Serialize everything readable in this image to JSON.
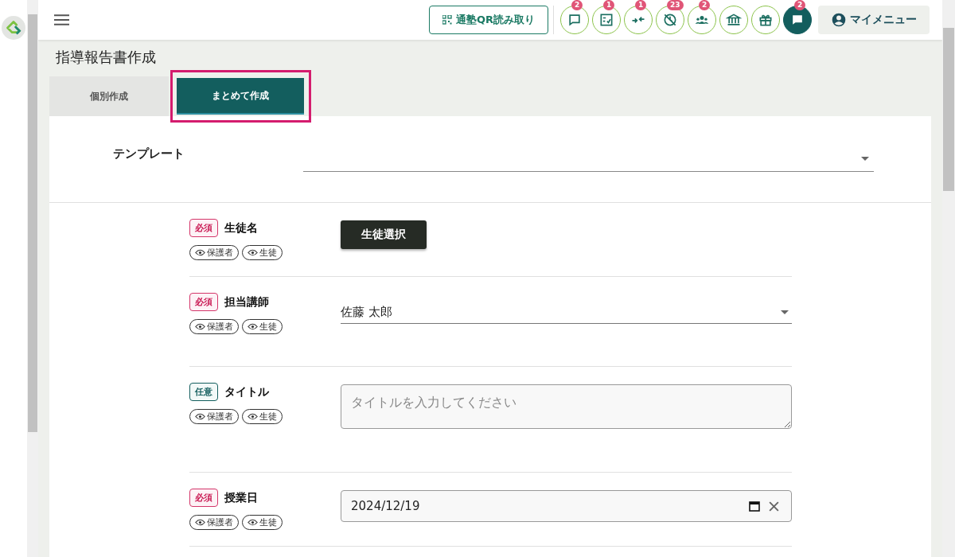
{
  "header": {
    "qr_button": "通塾QR読み取り",
    "icons": [
      {
        "kind": "message",
        "badge": "2"
      },
      {
        "kind": "checklist",
        "badge": "1"
      },
      {
        "kind": "arrows",
        "badge": "1"
      },
      {
        "kind": "no-clock",
        "badge": "23"
      },
      {
        "kind": "group",
        "badge": "2"
      },
      {
        "kind": "bank"
      },
      {
        "kind": "gift"
      },
      {
        "kind": "chat",
        "badge": "2"
      }
    ],
    "menu_button": "マイメニュー"
  },
  "page_title": "指導報告書作成",
  "tabs": [
    {
      "label": "個別作成",
      "selected": false
    },
    {
      "label": "まとめて作成",
      "selected": true
    }
  ],
  "template": {
    "label": "テンプレート"
  },
  "fields": [
    {
      "badge": "必須",
      "required": true,
      "label": "生徒名",
      "tags": [
        "保護者",
        "生徒"
      ],
      "kind": "button",
      "value": "生徒選択"
    },
    {
      "badge": "必須",
      "required": true,
      "label": "担当講師",
      "tags": [
        "保護者",
        "生徒"
      ],
      "kind": "select",
      "value": "佐藤 太郎"
    },
    {
      "badge": "任意",
      "required": false,
      "label": "タイトル",
      "tags": [
        "保護者",
        "生徒"
      ],
      "kind": "textarea",
      "placeholder": "タイトルを入力してください"
    },
    {
      "badge": "必須",
      "required": true,
      "label": "授業日",
      "tags": [
        "保護者",
        "生徒"
      ],
      "kind": "date",
      "value": "2024/12/19"
    }
  ]
}
